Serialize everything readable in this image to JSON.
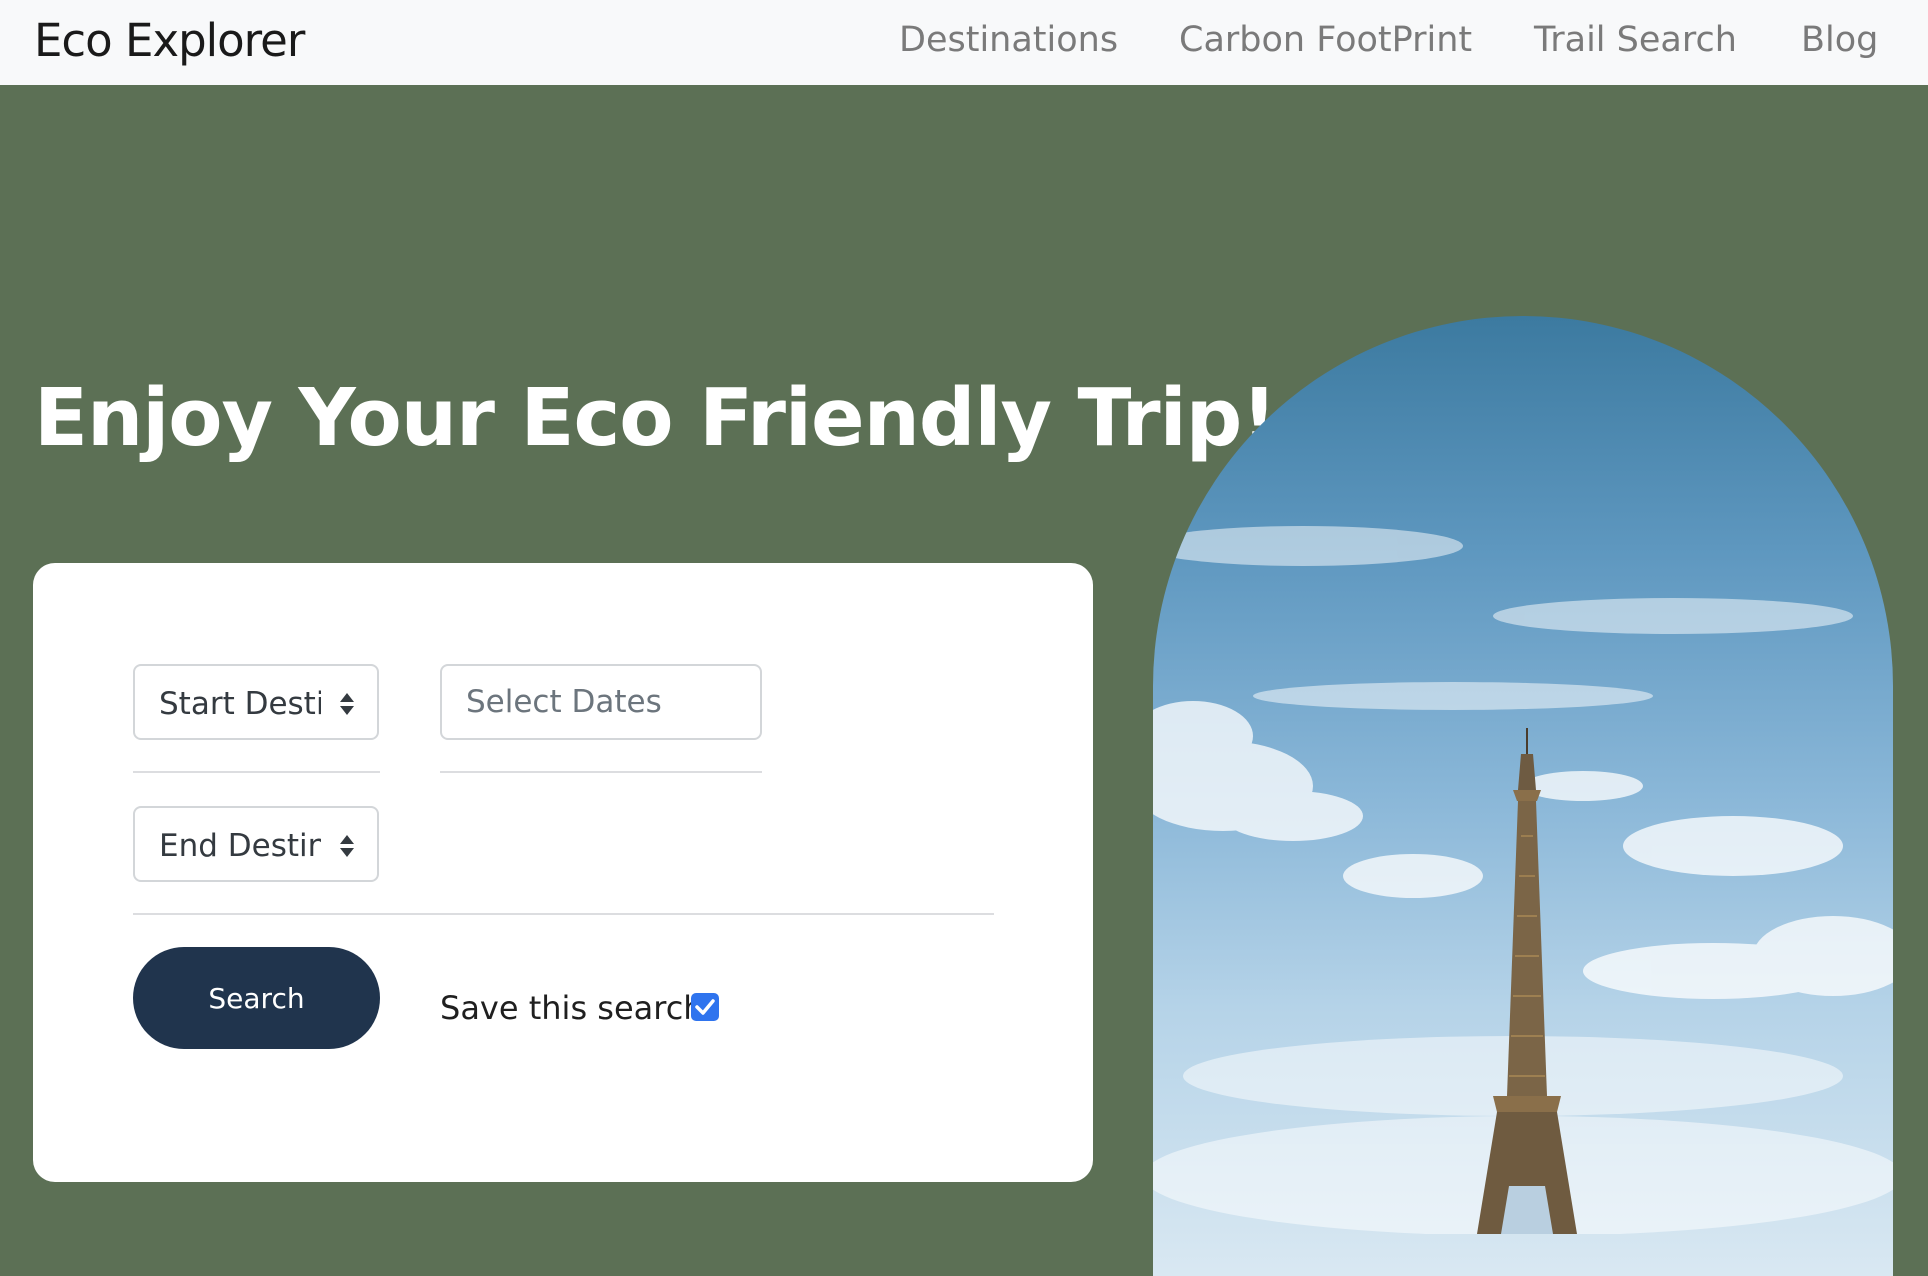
{
  "navbar": {
    "brand": "Eco Explorer",
    "links": [
      {
        "label": "Destinations"
      },
      {
        "label": "Carbon FootPrint"
      },
      {
        "label": "Trail Search"
      },
      {
        "label": "Blog"
      }
    ]
  },
  "hero": {
    "title": "Enjoy Your Eco Friendly Trip!"
  },
  "search_form": {
    "start_destination": "Start Destination",
    "end_destination": "End Destination",
    "dates_placeholder": "Select Dates",
    "dates_value": "",
    "search_label": "Search",
    "save_label": "Save this search",
    "save_checked": true
  },
  "hero_image": {
    "subject": "eiffel-tower"
  },
  "colors": {
    "background": "#5c7055",
    "navbar": "#f8f9fa",
    "button": "#20344d",
    "checkbox": "#2f74ee"
  }
}
